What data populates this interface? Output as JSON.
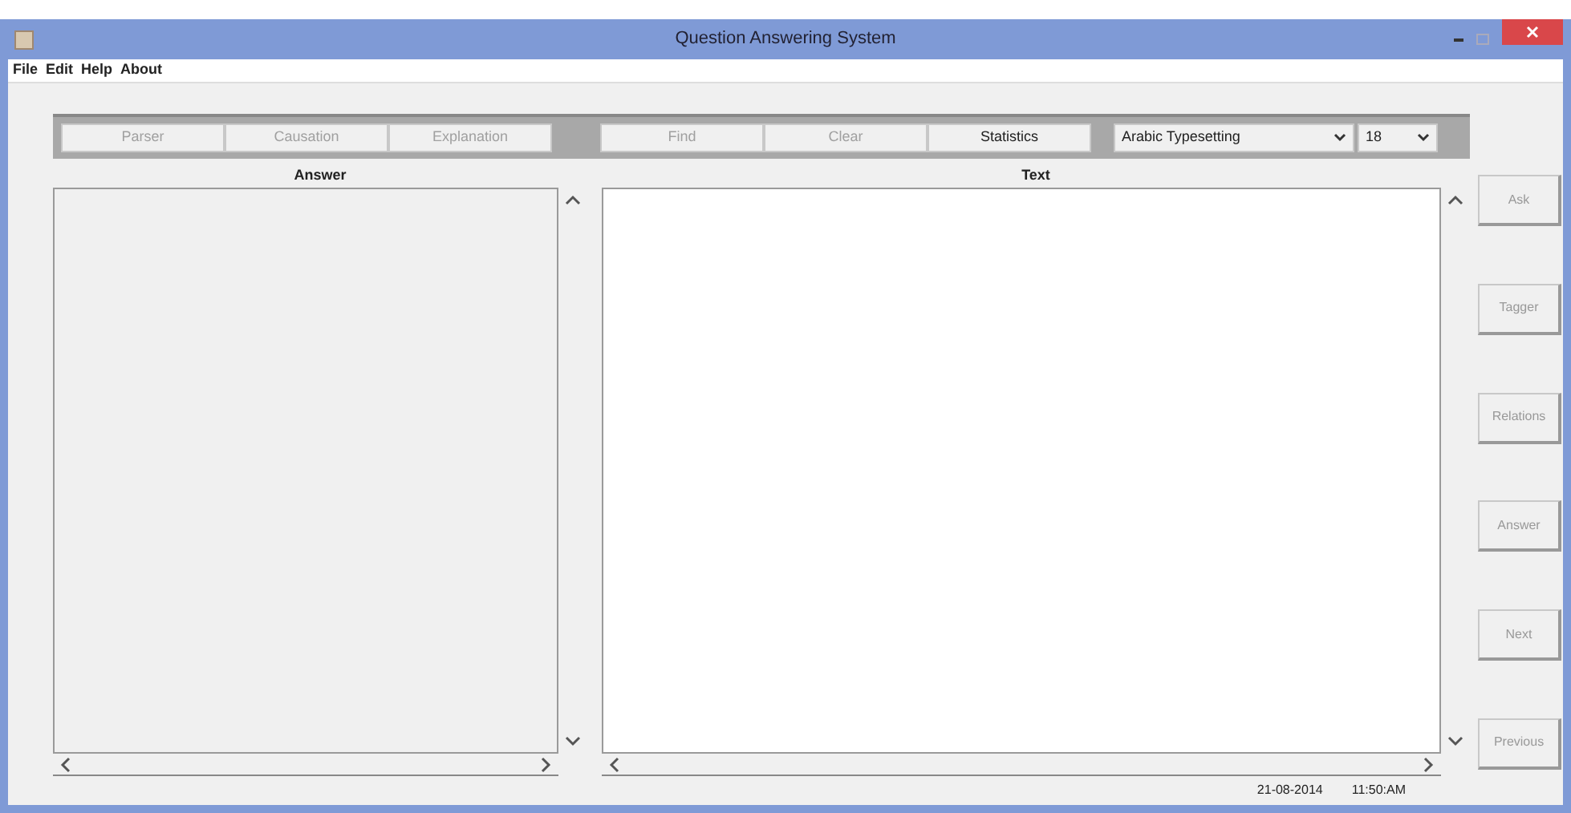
{
  "window": {
    "title": "Question Answering System"
  },
  "menu": [
    "File",
    "Edit",
    "Help",
    "About"
  ],
  "toolbar": {
    "analysis_buttons": [
      {
        "label": "Parser",
        "disabled": true
      },
      {
        "label": "Causation",
        "disabled": true
      },
      {
        "label": "Explanation",
        "disabled": true
      }
    ],
    "search_buttons": [
      {
        "label": "Find",
        "disabled": true
      },
      {
        "label": "Clear",
        "disabled": true
      },
      {
        "label": "Statistics",
        "disabled": false
      }
    ],
    "font_select": {
      "value": "Arabic Typesetting"
    },
    "size_select": {
      "value": "18"
    }
  },
  "answer_panel": {
    "label": "Answer"
  },
  "text_panel": {
    "label": "Text"
  },
  "side_buttons": [
    {
      "label": "Ask",
      "disabled": true
    },
    {
      "label": "Tagger",
      "disabled": true
    },
    {
      "label": "Relations",
      "disabled": true
    },
    {
      "label": "Answer",
      "disabled": true
    },
    {
      "label": "Next",
      "disabled": true
    },
    {
      "label": "Previous",
      "disabled": true
    }
  ],
  "status_bar": {
    "date": "21-08-2014",
    "time": "11:50:AM"
  }
}
